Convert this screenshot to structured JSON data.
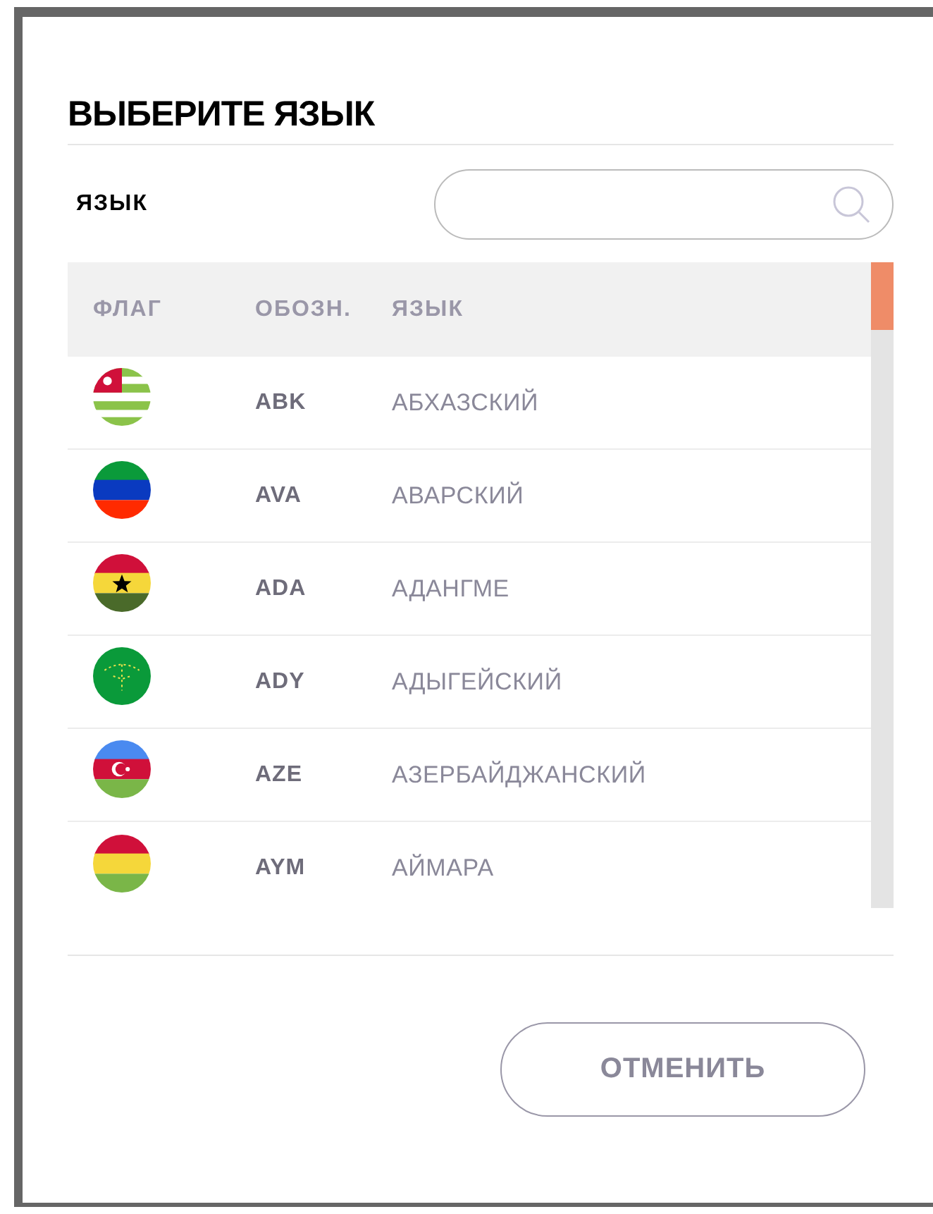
{
  "dialog": {
    "title": "ВЫБЕРИТЕ ЯЗЫК"
  },
  "search": {
    "label": "ЯЗЫК"
  },
  "table": {
    "columns": [
      "ФЛАГ",
      "ОБОЗН.",
      "ЯЗЫК"
    ],
    "rows": [
      {
        "code": "ABK",
        "language": "АБХАЗСКИЙ"
      },
      {
        "code": "AVA",
        "language": "АВАРСКИЙ"
      },
      {
        "code": "ADA",
        "language": "АДАНГМЕ"
      },
      {
        "code": "ADY",
        "language": "АДЫГЕЙСКИЙ"
      },
      {
        "code": "AZE",
        "language": "АЗЕРБАЙДЖАНСКИЙ"
      },
      {
        "code": "AYM",
        "language": "АЙМАРА"
      }
    ]
  },
  "buttons": [
    "ОТМЕНИТЬ"
  ]
}
